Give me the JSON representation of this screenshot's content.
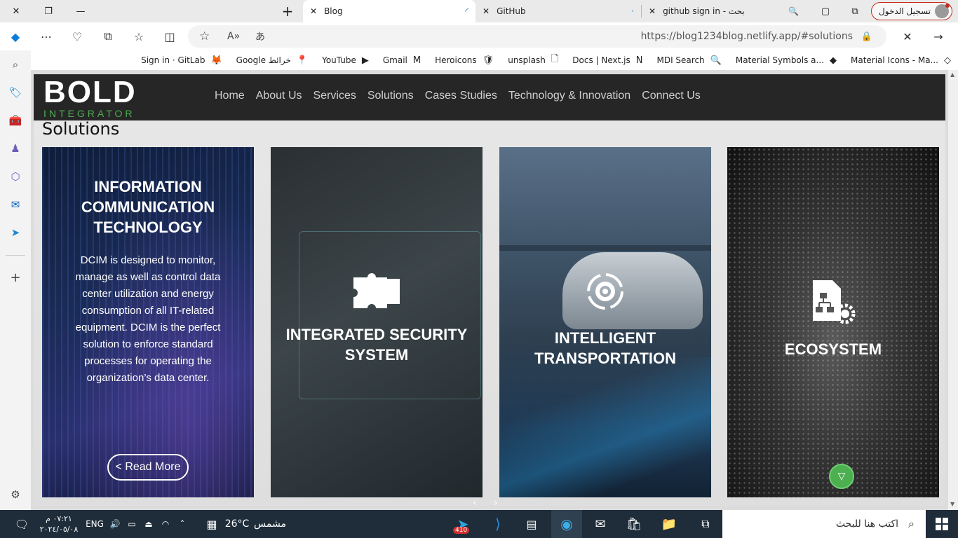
{
  "browser": {
    "tabs": [
      {
        "label": "Blog",
        "active": true
      },
      {
        "label": "GitHub",
        "active": false
      },
      {
        "label": "github sign in - بحث",
        "active": false
      }
    ],
    "signin_label": "تسجيل الدخول",
    "url": "https://blog1234blog.netlify.app/#solutions"
  },
  "bookmarks": [
    {
      "label": "Sign in · GitLab",
      "icon": "🦊"
    },
    {
      "label": "Google خرائط",
      "icon": "📍"
    },
    {
      "label": "YouTube",
      "icon": "▶"
    },
    {
      "label": "Gmail",
      "icon": "M"
    },
    {
      "label": "Heroicons",
      "icon": "🛡"
    },
    {
      "label": "unsplash",
      "icon": "🗋"
    },
    {
      "label": "Docs | Next.js",
      "icon": "N"
    },
    {
      "label": "MDI Search",
      "icon": "🔍"
    },
    {
      "label": "Material Symbols a...",
      "icon": "◆"
    },
    {
      "label": "Material Icons - Ma...",
      "icon": "◇"
    }
  ],
  "site": {
    "nav": [
      "Home",
      "About Us",
      "Services",
      "Solutions",
      "Cases Studies",
      "Technology & Innovation",
      "Connect Us"
    ],
    "logo_main": "BOLD",
    "logo_sub": "INTEGRATOR",
    "section_title": "Solutions",
    "cards": [
      {
        "title": "INFORMATION COMMUNICATION TECHNOLOGY",
        "desc": "DCIM is designed to monitor, manage as well as control data center utilization and energy consumption of all IT-related equipment. DCIM is the perfect solution to enforce standard processes for operating the organization’s data center.",
        "button": "< Read More"
      },
      {
        "title": "INTEGRATED SECURITY SYSTEM"
      },
      {
        "title": "INTELLIGENT TRANSPORTATION"
      },
      {
        "title": "ECOSYSTEM"
      }
    ]
  },
  "taskbar": {
    "time": "٠٧:٢١ م",
    "date": "٢٠٢٤/٠٥/٠٨",
    "lang": "ENG",
    "temp": "26°C",
    "weather": "مشمس",
    "search_placeholder": "اكتب هنا للبحث",
    "telegram_badge": "410"
  }
}
